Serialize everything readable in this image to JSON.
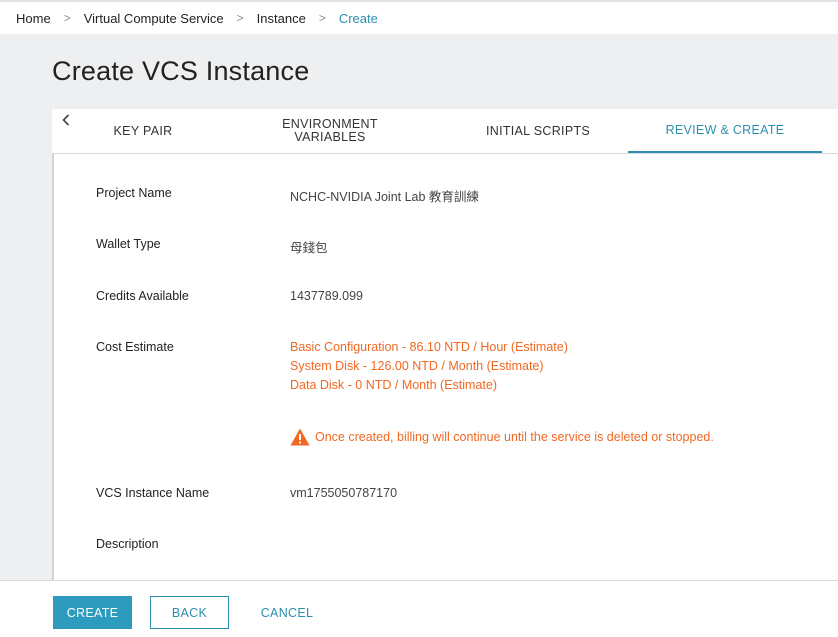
{
  "breadcrumb": {
    "items": [
      "Home",
      "Virtual Compute Service",
      "Instance",
      "Create"
    ],
    "separator": ">"
  },
  "page": {
    "title": "Create VCS Instance"
  },
  "tabs": [
    {
      "label": "KEY PAIR",
      "active": false
    },
    {
      "label": "ENVIRONMENT VARIABLES",
      "line1": "ENVIRONMENT",
      "line2": "VARIABLES",
      "active": false
    },
    {
      "label": "INITIAL SCRIPTS",
      "active": false
    },
    {
      "label": "REVIEW & CREATE",
      "active": true
    }
  ],
  "review": {
    "project_name": {
      "label": "Project Name",
      "value": "NCHC-NVIDIA Joint Lab 教育訓練"
    },
    "wallet_type": {
      "label": "Wallet Type",
      "value": "母錢包"
    },
    "credits_available": {
      "label": "Credits Available",
      "value": "1437789.099"
    },
    "cost_estimate": {
      "label": "Cost Estimate",
      "lines": [
        "Basic Configuration - 86.10 NTD / Hour (Estimate)",
        "System Disk - 126.00 NTD / Month (Estimate)",
        "Data Disk - 0 NTD / Month (Estimate)"
      ],
      "warning": "Once created, billing will continue until the service is deleted or stopped."
    },
    "instance_name": {
      "label": "VCS Instance Name",
      "value": "vm1755050787170"
    },
    "description": {
      "label": "Description",
      "value": ""
    }
  },
  "footer": {
    "create_label": "CREATE",
    "back_label": "BACK",
    "cancel_label": "CANCEL"
  },
  "colors": {
    "accent": "#2c8fb0",
    "primary_button": "#2c9bbd",
    "warning": "#f26722",
    "page_background": "#edeff1"
  },
  "icons": {
    "tab_scroll": "chevron-left-icon",
    "warning": "warning-triangle-icon"
  }
}
